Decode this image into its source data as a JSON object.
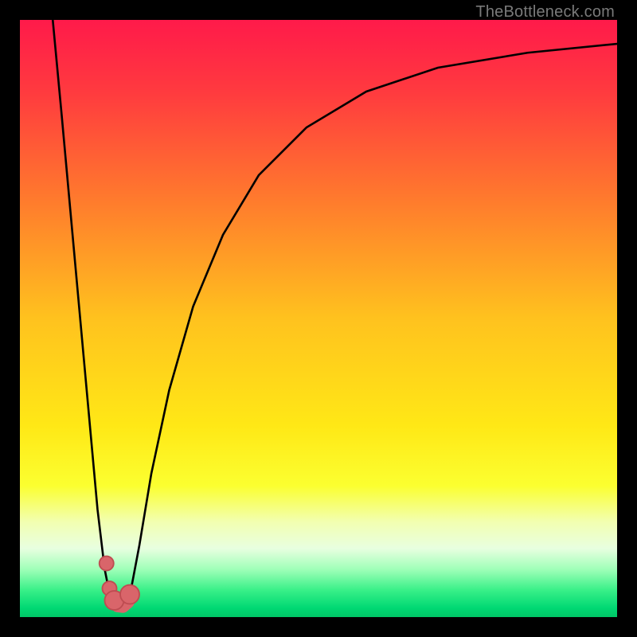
{
  "attribution": "TheBottleneck.com",
  "colors": {
    "frame": "#000000",
    "curve": "#000000",
    "marker_fill": "#d9656a",
    "marker_stroke": "#be4c51",
    "gradient_stops": [
      {
        "offset": 0.0,
        "color": "#ff1a4a"
      },
      {
        "offset": 0.12,
        "color": "#ff3a3f"
      },
      {
        "offset": 0.3,
        "color": "#ff7a2d"
      },
      {
        "offset": 0.5,
        "color": "#ffc21e"
      },
      {
        "offset": 0.68,
        "color": "#ffe816"
      },
      {
        "offset": 0.78,
        "color": "#fbff30"
      },
      {
        "offset": 0.84,
        "color": "#f2ffb0"
      },
      {
        "offset": 0.885,
        "color": "#e8ffe0"
      },
      {
        "offset": 0.92,
        "color": "#9fffb8"
      },
      {
        "offset": 0.955,
        "color": "#38f088"
      },
      {
        "offset": 0.985,
        "color": "#00d873"
      },
      {
        "offset": 1.0,
        "color": "#00c766"
      }
    ]
  },
  "chart_data": {
    "type": "line",
    "title": "",
    "xlabel": "",
    "ylabel": "",
    "xlim": [
      0,
      100
    ],
    "ylim": [
      0,
      100
    ],
    "grid": false,
    "legend": false,
    "note": "Values estimated from pixel positions; axes unlabeled in source image.",
    "series": [
      {
        "name": "left-branch",
        "x": [
          5.5,
          7,
          9,
          11,
          13,
          14.2,
          15.3
        ],
        "y": [
          100,
          84,
          62,
          40,
          18,
          8,
          2.5
        ]
      },
      {
        "name": "right-branch",
        "x": [
          18.2,
          20,
          22,
          25,
          29,
          34,
          40,
          48,
          58,
          70,
          85,
          100
        ],
        "y": [
          2.5,
          12,
          24,
          38,
          52,
          64,
          74,
          82,
          88,
          92,
          94.5,
          96
        ]
      }
    ],
    "markers": [
      {
        "name": "dot-upper",
        "x": 14.5,
        "y": 9.0,
        "r": 1.2
      },
      {
        "name": "dot-lower",
        "x": 15.0,
        "y": 4.8,
        "r": 1.2
      },
      {
        "name": "valley-cap-left",
        "x": 15.8,
        "y": 2.8,
        "r": 1.6
      },
      {
        "name": "valley-cap-right",
        "x": 18.4,
        "y": 3.8,
        "r": 1.6
      }
    ],
    "valley_segment": {
      "x": [
        15.8,
        16.4,
        17.2,
        18.0,
        18.4
      ],
      "y": [
        2.8,
        2.0,
        1.9,
        2.6,
        3.8
      ]
    }
  }
}
